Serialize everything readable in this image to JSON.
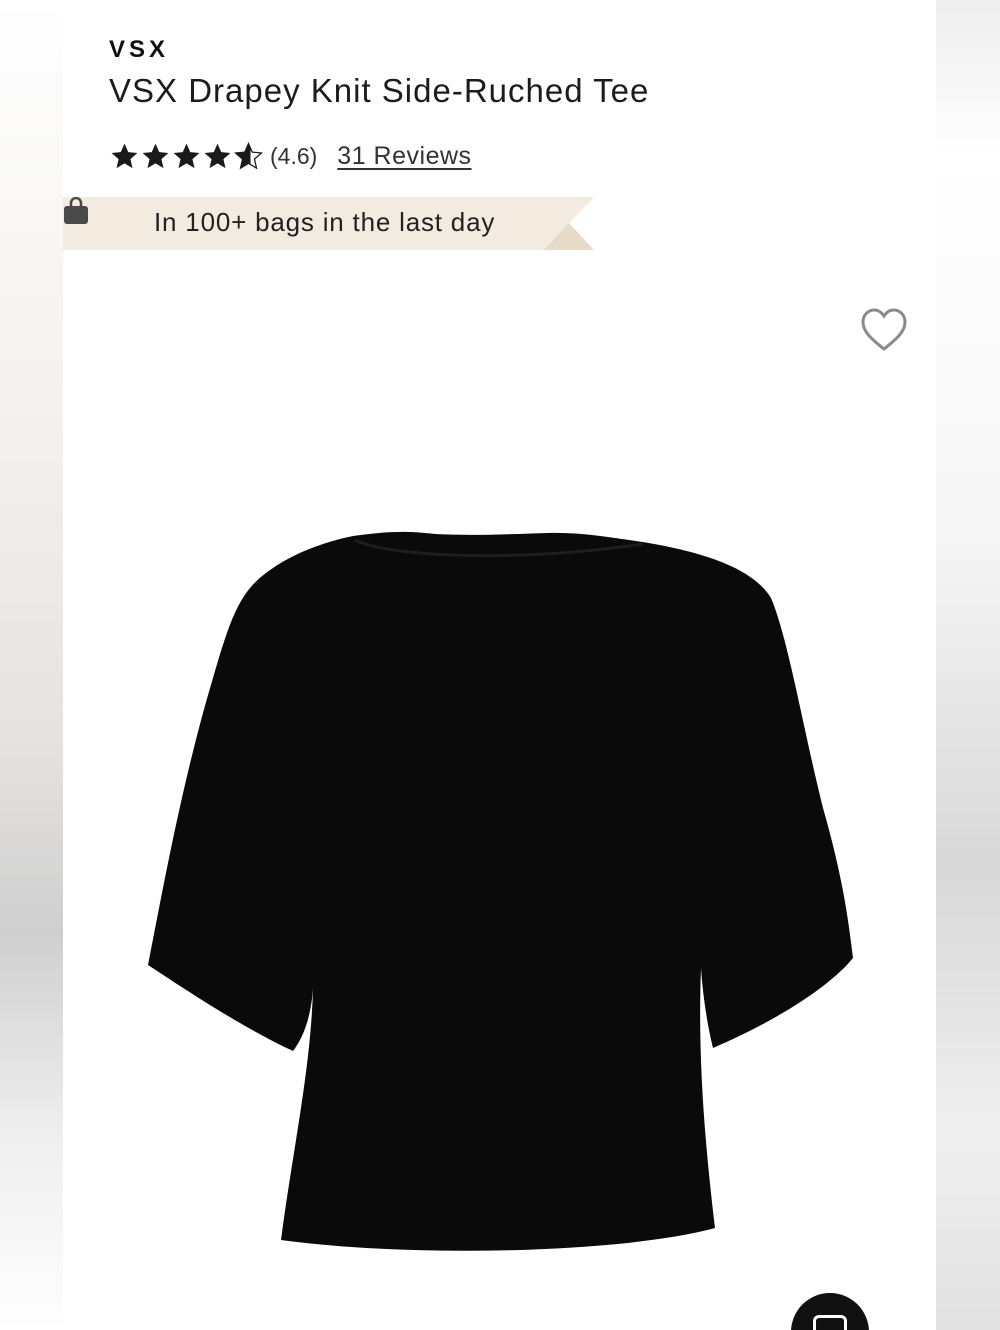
{
  "product": {
    "brand": "VSX",
    "title": "VSX Drapey Knit Side-Ruched Tee",
    "rating_display": "(4.6)",
    "rating_value": 4.6,
    "rating_max": 5,
    "reviews_label": "31 Reviews"
  },
  "banner": {
    "text": "In 100+ bags in the last day",
    "icon": "shopping-bag-icon",
    "background_color": "#f3ebe0"
  },
  "actions": {
    "wishlist_icon": "heart-outline-icon",
    "chat_icon": "chat-icon"
  },
  "image": {
    "description_icon": "black-tee-product-photo"
  },
  "colors": {
    "text": "#1a1a1a",
    "star": "#1a1a1a",
    "product": "#0a0a0a",
    "chat_button": "#111111"
  }
}
